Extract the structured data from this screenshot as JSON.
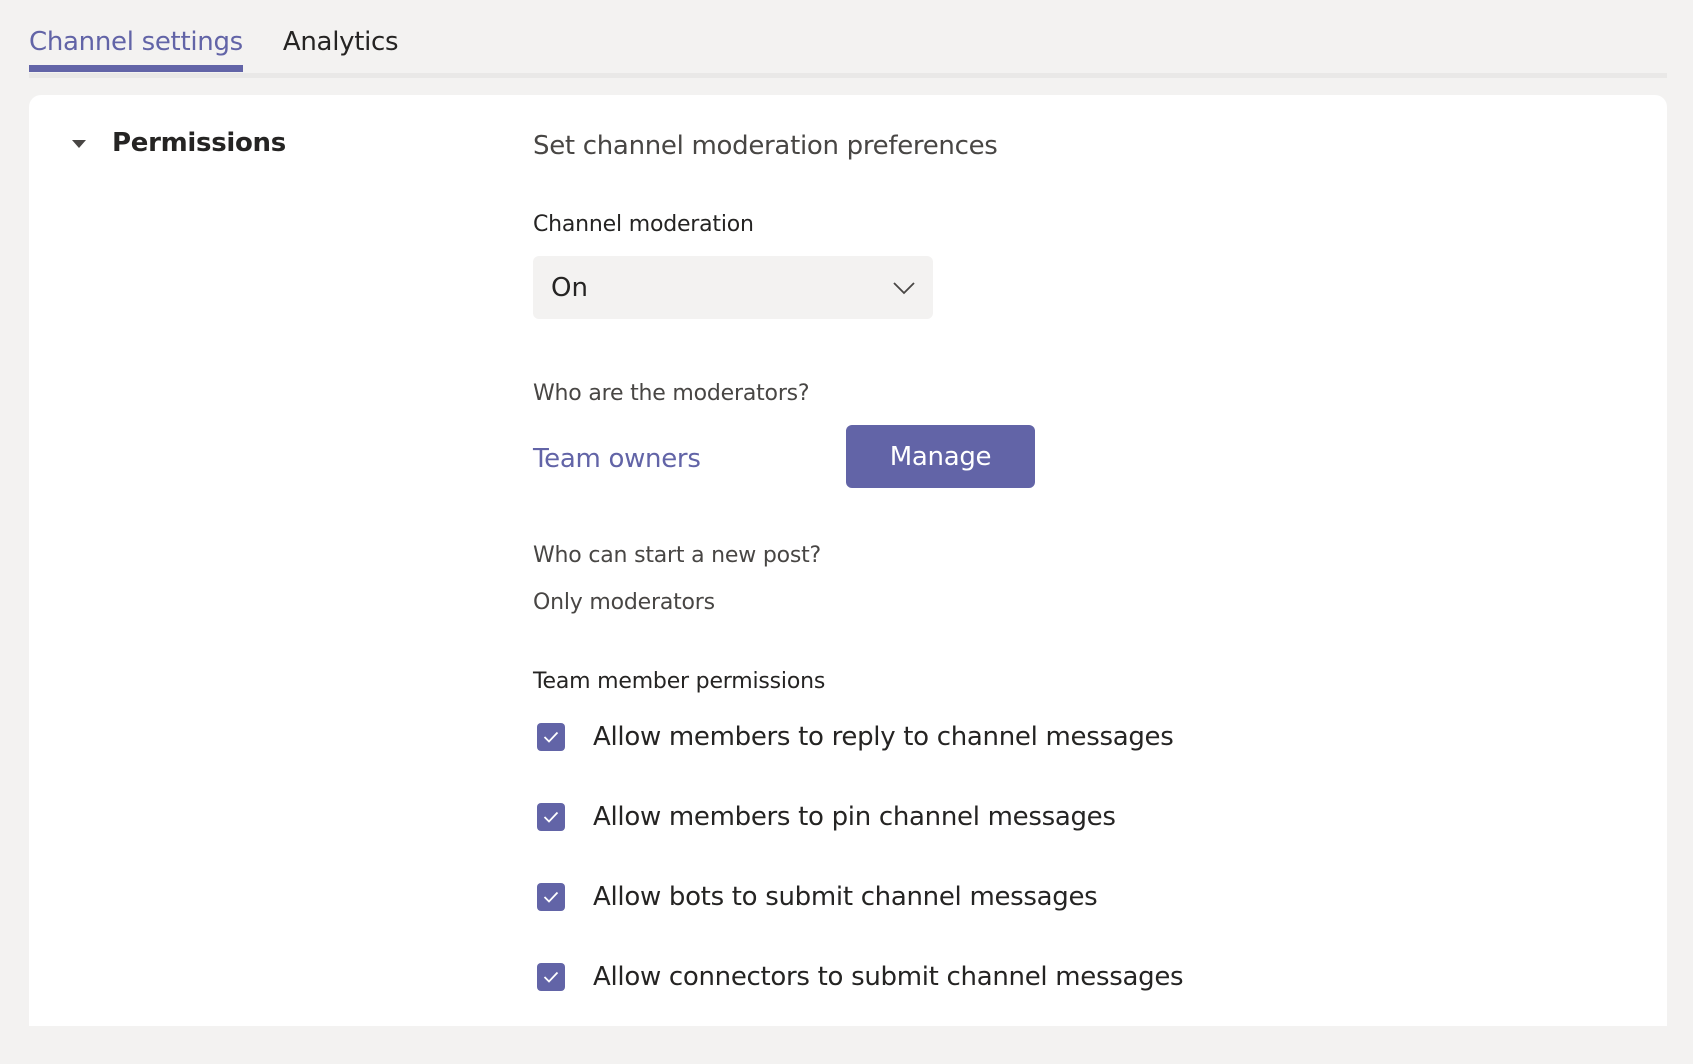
{
  "tabs": [
    {
      "label": "Channel settings",
      "active": true
    },
    {
      "label": "Analytics",
      "active": false
    }
  ],
  "section": {
    "title": "Permissions",
    "expanded": true
  },
  "moderation": {
    "heading": "Set channel moderation preferences",
    "channel_moderation_label": "Channel moderation",
    "channel_moderation_value": "On",
    "moderators_label": "Who are the moderators?",
    "moderators_value": "Team owners",
    "manage_button": "Manage",
    "new_post_label": "Who can start a new post?",
    "new_post_value": "Only moderators",
    "member_permissions_label": "Team member permissions",
    "permissions": [
      {
        "label": "Allow members to reply to channel messages",
        "checked": true
      },
      {
        "label": "Allow members to pin channel messages",
        "checked": true
      },
      {
        "label": "Allow bots to submit channel messages",
        "checked": true
      },
      {
        "label": "Allow connectors to submit channel messages",
        "checked": true
      }
    ]
  },
  "colors": {
    "accent": "#6264a7",
    "background": "#f3f2f1",
    "card": "#ffffff",
    "text": "#252423"
  }
}
